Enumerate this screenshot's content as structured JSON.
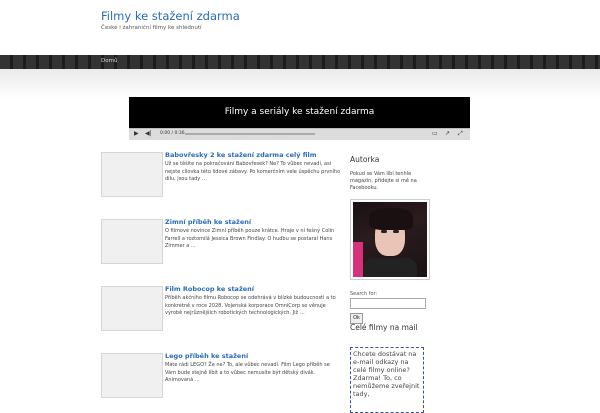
{
  "header": {
    "site_title": "Filmy ke stažení zdarma",
    "tagline": "České i zahraniční filmy ke shlédnutí"
  },
  "nav": {
    "items": [
      "Domů"
    ]
  },
  "video": {
    "title": "Filmy a seriály ke stažení zdarma",
    "time": "0:00 / 0:36"
  },
  "posts": [
    {
      "title": "Babovřesky 2 ke stažení zdarma celý film",
      "excerpt": "Už se těšíte na pokračování Babovřesek? Ne? To vůbec nevadí, asi nejste cílovka této lidové zábavy. Po komerčním vele úspěchu prvního dílu, jsou tady …"
    },
    {
      "title": "Zimní příběh ke stažení",
      "excerpt": "O filmové novince Zimní příběh pouze krátce. Hraje v ní fešný Colin Farrell a roztomilá Jessica Brown Findlay. O hudbu se postaral Hans Zimmer a …"
    },
    {
      "title": "Film Robocop ke stažení",
      "excerpt": "Příběh akčního filmu Robocop se odehrává v blízké budoucnosti a to konkrétně v roce 2028. Vojenská korporace OmniCorp se věnuje výrobě nejrůznějších robotických technologických. Již …"
    },
    {
      "title": "Lego příběh ke stažení",
      "excerpt": "Máte rádi LEGO? Že ne? To, ale vůbec nevadí. Film Lego příběh se Vám bude stejně líbit a to vůbec nemusíte být dětský divák. Animovaná …"
    }
  ],
  "sidebar": {
    "author_heading": "Autorka",
    "author_text": "Pokud se Vám líbí tenhle magazín, přidejte si mě na Facebooku.",
    "search_label": "Search for:",
    "search_value": "",
    "ok_label": "Ok",
    "films_heading": "Celé filmy na mail",
    "promo_text": "Chcete dostávat na e-mail odkazy na celé filmy online? Zdarma! To, co nemůžeme zveřejnit tady,"
  }
}
